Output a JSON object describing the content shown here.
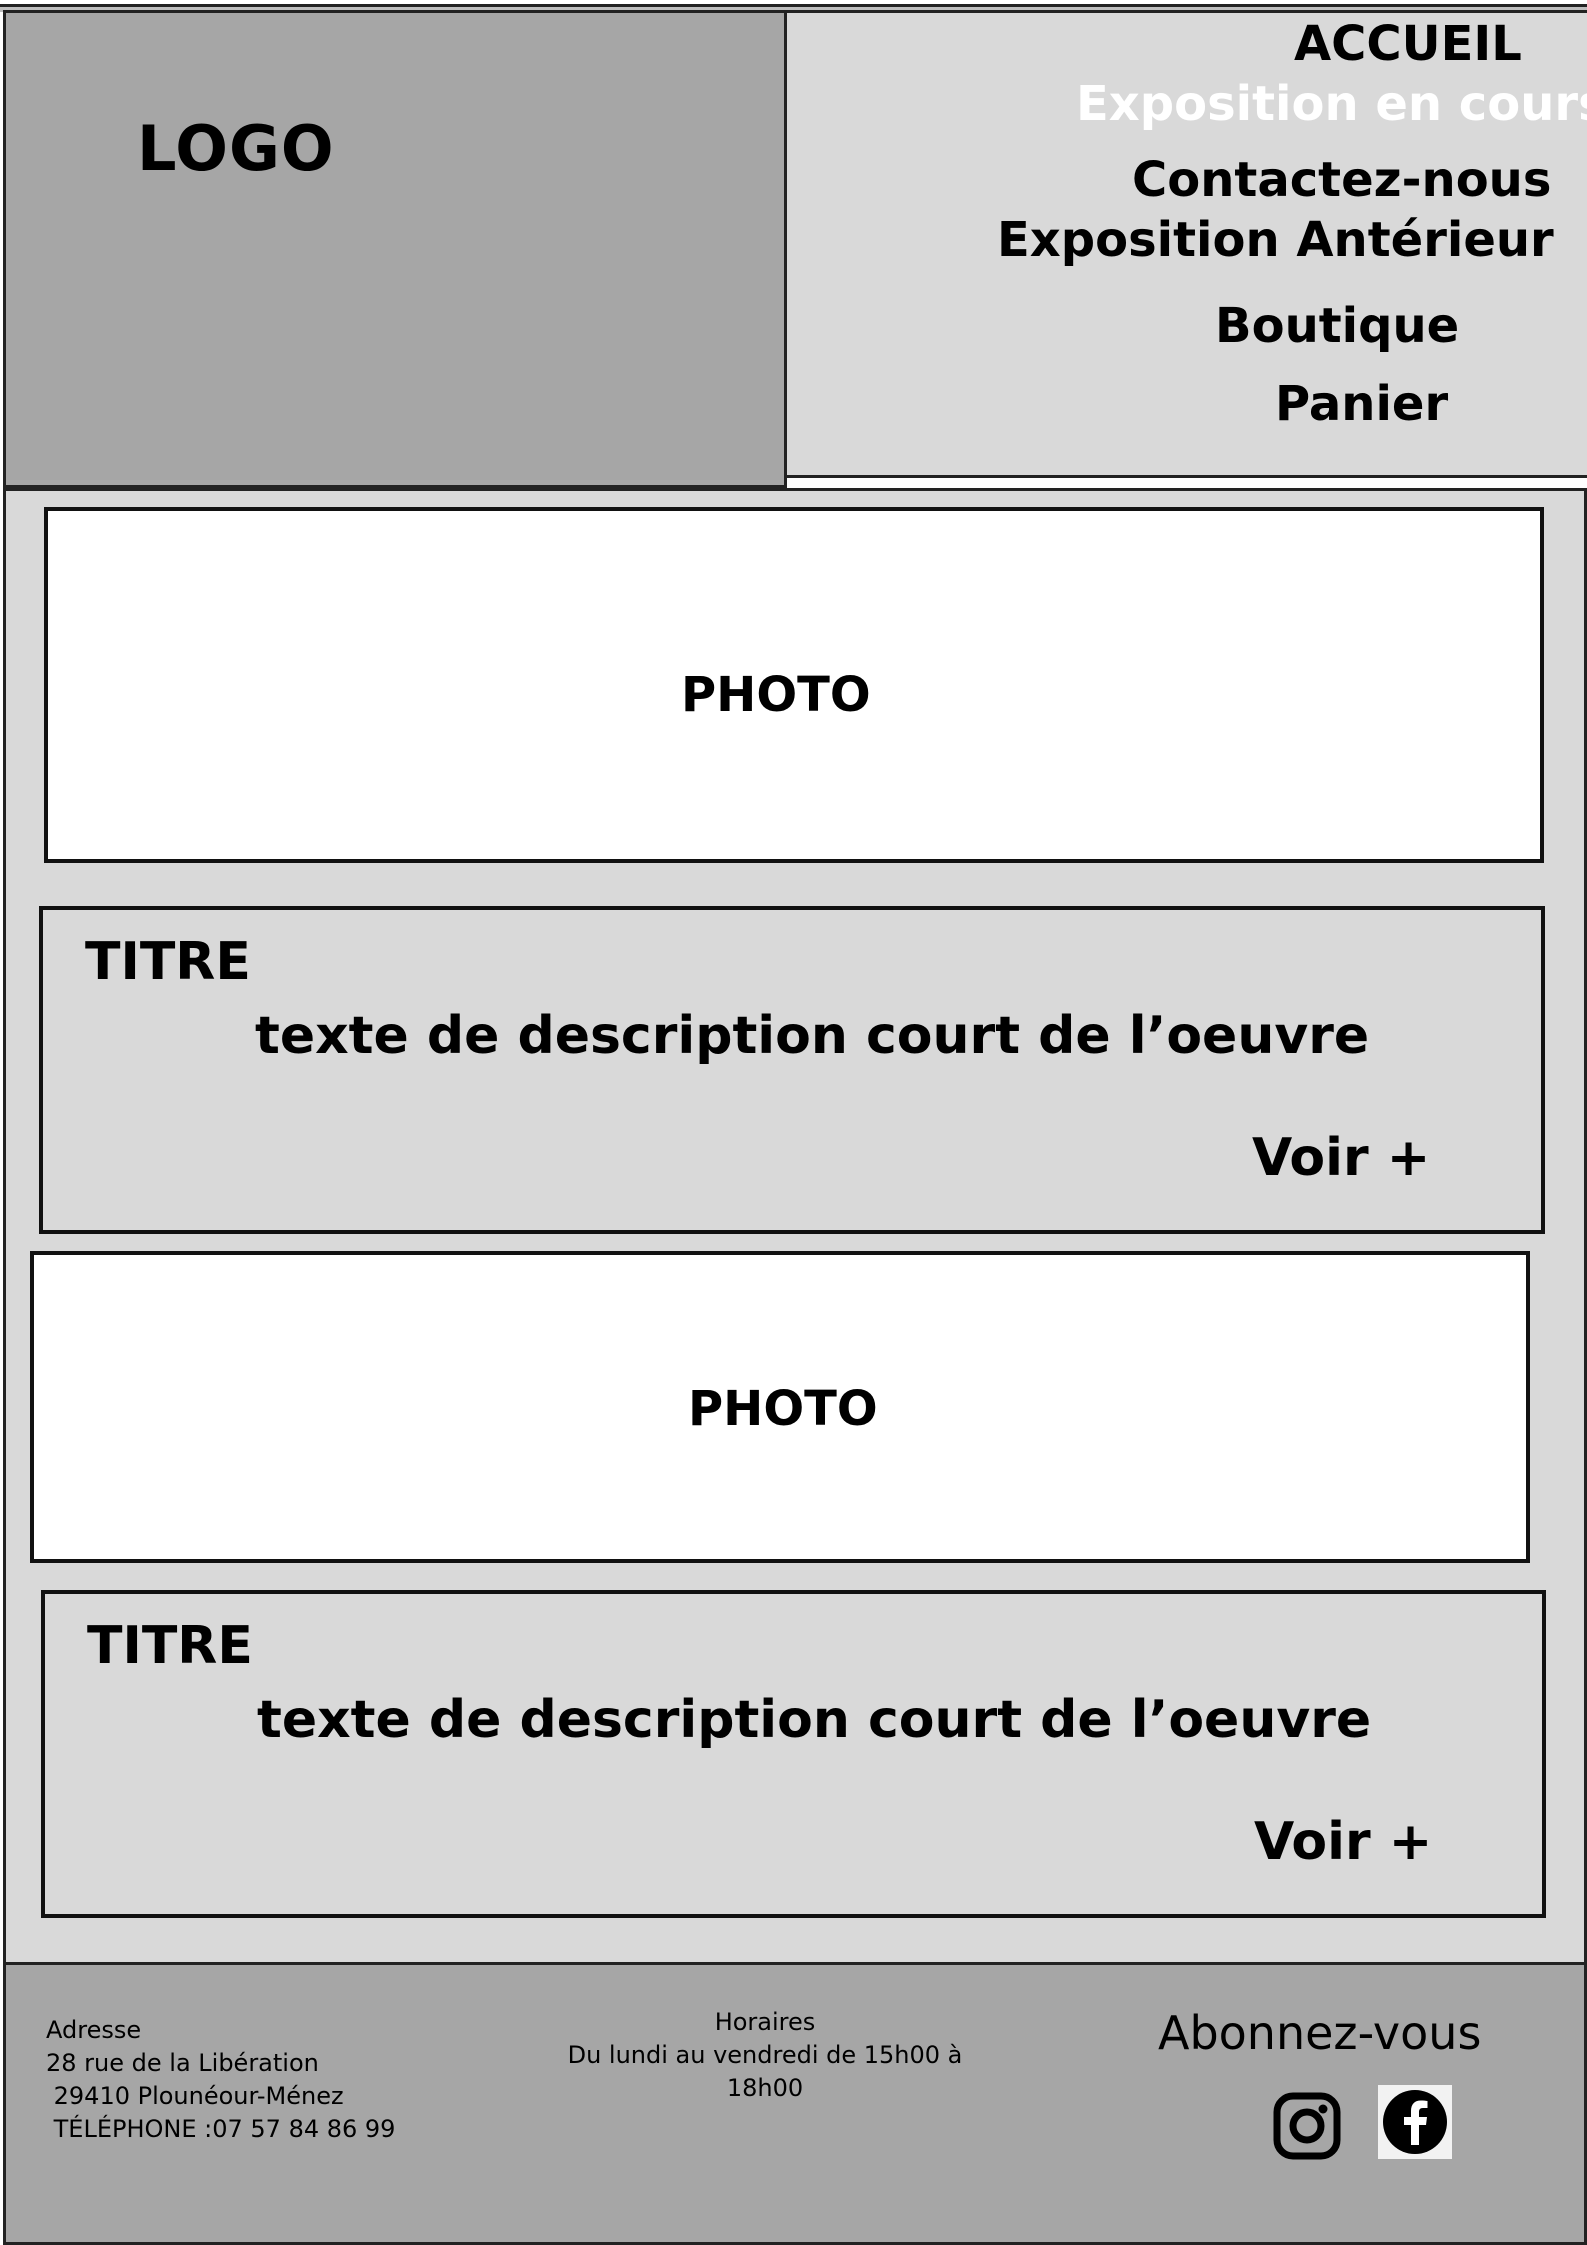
{
  "header": {
    "logo": "LOGO",
    "nav": {
      "accueil": "ACCUEIL",
      "exposition_en_cours": "Exposition en cours",
      "contact": "Contactez-nous",
      "anterieur": "Exposition Antérieur",
      "boutique": "Boutique",
      "panier": "Panier"
    }
  },
  "main": {
    "items": [
      {
        "photo": "PHOTO",
        "title": "TITRE",
        "description": "texte de description court de l’oeuvre",
        "more": "Voir +"
      },
      {
        "photo": "PHOTO",
        "title": "TITRE",
        "description": "texte de description court de l’oeuvre",
        "more": "Voir +"
      }
    ]
  },
  "footer": {
    "address": {
      "label": "Adresse",
      "street": "28 rue de la Libération",
      "city": " 29410 Plounéour-Ménez",
      "phone": " TÉLÉPHONE :07 57 84 86 99"
    },
    "hours": {
      "label": "Horaires",
      "line1": "Du lundi au vendredi de 15h00 à",
      "line2": "18h00"
    },
    "subscribe": "Abonnez-vous",
    "social_icons": [
      "instagram-icon",
      "facebook-icon"
    ]
  },
  "colors": {
    "header_logo_bg": "#a6a6a6",
    "header_nav_bg": "#d9d9d9",
    "main_bg": "#d9d9d9",
    "photo_bg": "#ffffff",
    "footer_bg": "#a6a6a6",
    "active_nav": "#ffffff"
  }
}
